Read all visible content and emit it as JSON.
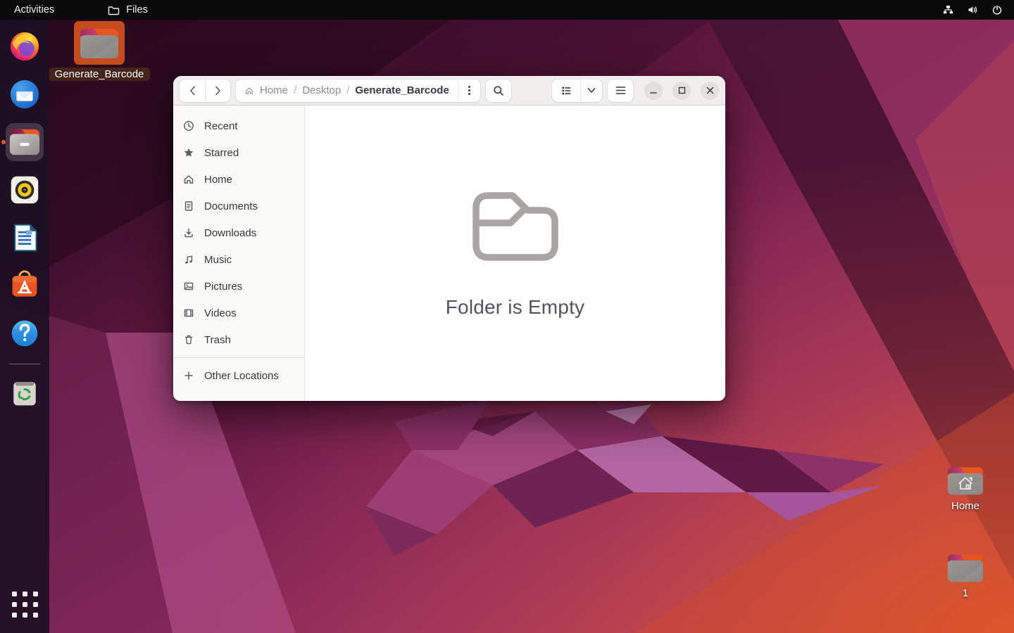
{
  "topbar": {
    "activities_label": "Activities",
    "app_menu_label": "Files",
    "status_icons": [
      "network-icon",
      "volume-icon",
      "power-icon"
    ]
  },
  "dock": {
    "items": [
      {
        "icon": "firefox-icon"
      },
      {
        "icon": "thunderbird-icon"
      },
      {
        "icon": "files-icon",
        "active": true
      },
      {
        "icon": "rhythmbox-icon"
      },
      {
        "icon": "libreoffice-writer-icon"
      },
      {
        "icon": "ubuntu-software-icon"
      },
      {
        "icon": "help-icon"
      },
      {
        "icon": "trash-icon"
      },
      {
        "icon": "show-apps-icon"
      }
    ]
  },
  "desktop": {
    "icons": [
      {
        "label": "Generate_Barcode",
        "icon": "folder-icon",
        "selected": true
      },
      {
        "label": "Home",
        "icon": "home-folder-icon",
        "selected": false
      },
      {
        "label": "1",
        "icon": "folder-icon",
        "selected": false
      }
    ]
  },
  "window": {
    "header": {
      "back_icon": "chevron-left-icon",
      "forward_icon": "chevron-right-icon",
      "breadcrumb": {
        "root_icon": "home-icon",
        "separator": "/",
        "segments": [
          "Home",
          "Desktop",
          "Generate_Barcode"
        ],
        "current": "Generate_Barcode"
      },
      "more_icon": "kebab-menu-icon",
      "search_icon": "search-icon",
      "view_icon": "list-view-icon",
      "view_dropdown_icon": "chevron-down-icon",
      "menu_icon": "hamburger-menu-icon",
      "minimize_icon": "minimize-icon",
      "maximize_icon": "maximize-icon",
      "close_icon": "close-icon"
    },
    "sidebar": {
      "items": [
        {
          "icon": "clock-icon",
          "label": "Recent"
        },
        {
          "icon": "star-icon",
          "label": "Starred"
        },
        {
          "icon": "home-icon",
          "label": "Home"
        },
        {
          "icon": "document-icon",
          "label": "Documents"
        },
        {
          "icon": "download-icon",
          "label": "Downloads"
        },
        {
          "icon": "music-note-icon",
          "label": "Music"
        },
        {
          "icon": "image-icon",
          "label": "Pictures"
        },
        {
          "icon": "film-icon",
          "label": "Videos"
        },
        {
          "icon": "trash-icon",
          "label": "Trash"
        }
      ],
      "other_locations": {
        "icon": "plus-icon",
        "label": "Other Locations"
      }
    },
    "empty_state": {
      "icon": "folder-outline-icon",
      "message": "Folder is Empty"
    }
  },
  "colors": {
    "accent_orange": "#e95420",
    "selection_orange": "#c54d1d",
    "topbar_bg": "#0a0a0a",
    "header_bg": "#f0eeec",
    "sidebar_bg": "#fafaf9",
    "wallpaper_dark": "#2b0a1f",
    "wallpaper_magenta": "#8e2f5e",
    "wallpaper_red": "#d14f28"
  }
}
